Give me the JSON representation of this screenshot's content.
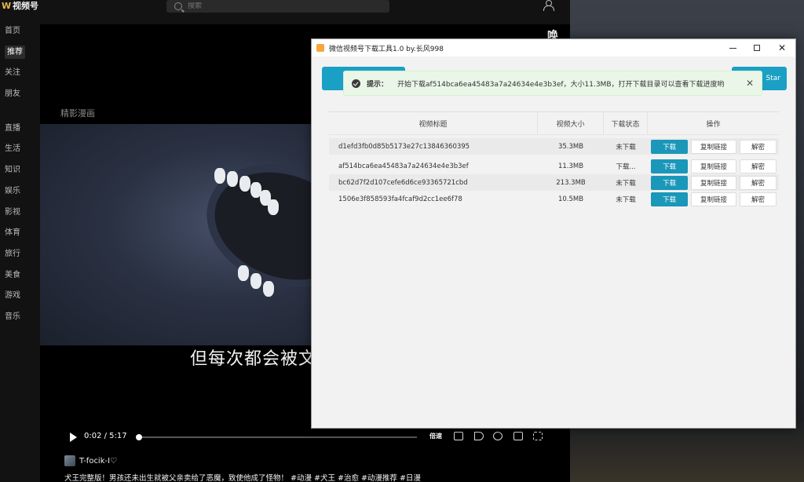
{
  "app": {
    "logo_text": "视频号",
    "search_placeholder": "搜索",
    "sidebar_top": [
      "首页",
      "推荐",
      "关注",
      "朋友"
    ],
    "sidebar_bottom": [
      "直播",
      "生活",
      "知识",
      "娱乐",
      "影视",
      "体育",
      "旅行",
      "美食",
      "游戏",
      "音乐"
    ]
  },
  "player": {
    "channel_label": "精影漫画",
    "subtitle": "但每次都会被文",
    "corner_char": "唤",
    "time": "0:02 / 5:17",
    "progress_fraction": 0.006,
    "speed_label": "倍速",
    "author": "T-focik-I♡",
    "description": "犬王完整版！男孩还未出生就被父亲卖给了恶魔，致使他成了怪物！ #动漫 #犬王 #治愈 #动漫推荐 #日漫"
  },
  "downloader": {
    "title": "微信视频号下载工具1.0 by.长风998",
    "right_button_label": "Star",
    "toast": {
      "title": "提示：",
      "message": "开始下载af514bca6ea45483a7a24634e4e3b3ef，大小11.3MB，打开下载目录可以查看下载进度哟"
    },
    "columns": [
      "视频标题",
      "视频大小",
      "下载状态",
      "操作"
    ],
    "rows": [
      {
        "title": "d1efd3fb0d85b5173e27c13846360395",
        "size": "35.3MB",
        "status": "未下载"
      },
      {
        "title": "af514bca6ea45483a7a24634e4e3b3ef",
        "size": "11.3MB",
        "status": "下载..."
      },
      {
        "title": "bc62d7f2d107cefe6d6ce93365721cbd",
        "size": "213.3MB",
        "status": "未下载"
      },
      {
        "title": "1506e3f858593fa4fcaf9d2cc1ee6f78",
        "size": "10.5MB",
        "status": "未下载"
      }
    ],
    "actions": {
      "download": "下载",
      "copy_link": "复制链接",
      "decrypt": "解密"
    }
  },
  "colors": {
    "accent": "#1a97b9",
    "logo": "#e8b64a",
    "toast_bg": "#eaf7e8"
  }
}
